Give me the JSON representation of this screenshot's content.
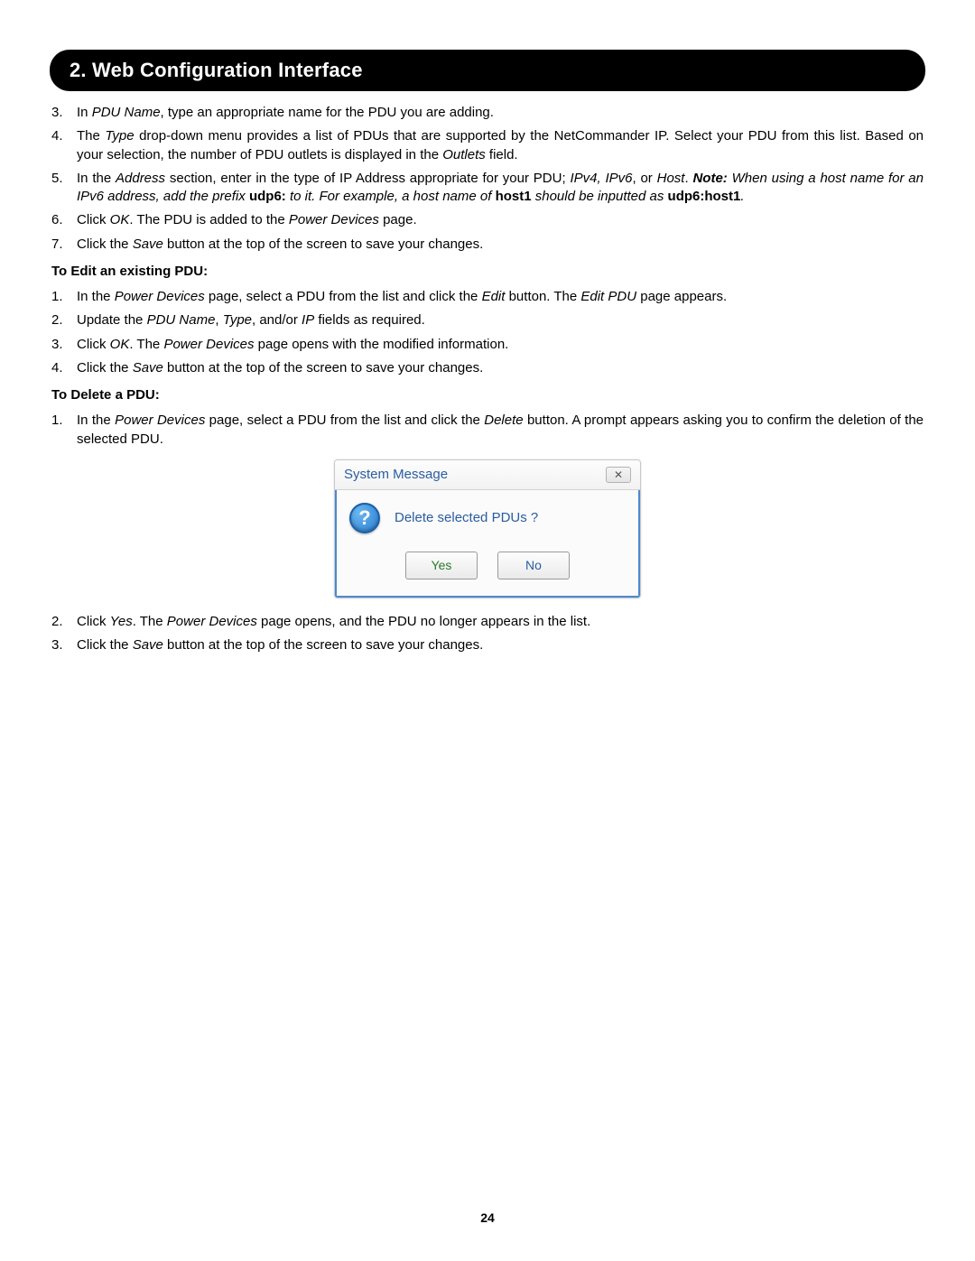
{
  "header": {
    "title": "2. Web Configuration Interface"
  },
  "list1": [
    {
      "n": "3.",
      "before": "In ",
      "i1": "PDU Name",
      "after": ", type an appropriate name for the PDU you are adding."
    },
    {
      "n": "4.",
      "html": "The <em>Type</em> drop-down menu provides a list of PDUs that are supported by the NetCommander IP. Select your PDU from this list. Based on your selection, the number of PDU outlets is displayed in the <em>Outlets</em> field."
    },
    {
      "n": "5.",
      "html": "In the <em>Address</em> section, enter in the type of IP Address appropriate for your PDU; <em>IPv4, IPv6</em>, or <em>Host</em>. <span class='bolditalic'>Note:</span> <em>When using a host name for an IPv6 address, add the prefix </em><span class='bold'>udp6:</span><em> to it. For example, a host name of </em><span class='bold'>host1</span><em> should be inputted as </em><span class='bold'>udp6:host1</span><em>.</em>"
    },
    {
      "n": "6.",
      "html": "Click <em>OK</em>. The PDU is added to the <em>Power Devices</em> page."
    },
    {
      "n": "7.",
      "html": "Click the <em>Save</em> button at the top of the screen to save your changes."
    }
  ],
  "sub1": "To Edit an existing PDU:",
  "list2": [
    {
      "n": "1.",
      "html": "In the <em>Power Devices</em> page, select a PDU from the list and click the <em>Edit</em> button. The <em>Edit PDU</em> page appears."
    },
    {
      "n": "2.",
      "html": "Update the <em>PDU Name</em>, <em>Type</em>, and/or <em>IP</em> fields as required."
    },
    {
      "n": "3.",
      "html": "Click <em>OK</em>. The <em>Power Devices</em> page opens with the modified information."
    },
    {
      "n": "4.",
      "html": "Click the <em>Save</em> button at the top of the screen to save your changes."
    }
  ],
  "sub2": "To Delete a PDU:",
  "list3a": [
    {
      "n": "1.",
      "html": "In the <em>Power Devices</em> page, select a PDU from the list and click the <em>Delete</em> button. A prompt appears asking you to confirm the deletion of the selected PDU."
    }
  ],
  "dialog": {
    "title": "System Message",
    "message": "Delete selected PDUs ?",
    "yes": "Yes",
    "no": "No",
    "close_glyph": "✕",
    "icon_glyph": "?"
  },
  "list3b": [
    {
      "n": "2.",
      "html": "Click <em>Yes</em>. The <em>Power Devices</em> page opens, and the PDU no longer appears in the list."
    },
    {
      "n": "3.",
      "html": "Click the <em>Save</em> button at the top of the screen to save your changes."
    }
  ],
  "page_number": "24"
}
